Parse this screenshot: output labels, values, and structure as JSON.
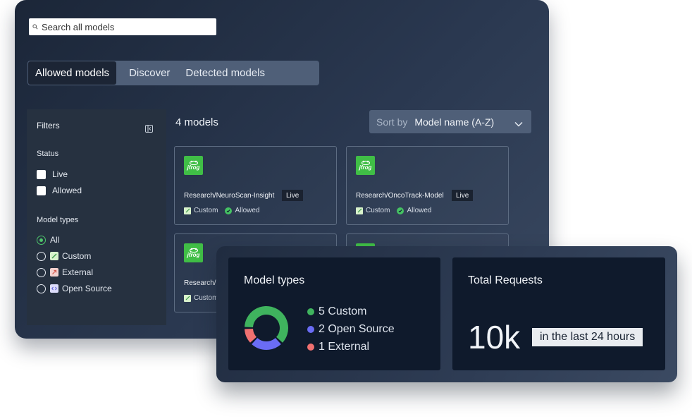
{
  "search": {
    "placeholder": "Search all models"
  },
  "tabs": [
    {
      "label": "Allowed models",
      "active": true
    },
    {
      "label": "Discover",
      "active": false
    },
    {
      "label": "Detected models",
      "active": false
    }
  ],
  "filters": {
    "title": "Filters",
    "status_label": "Status",
    "status_options": [
      "Live",
      "Allowed"
    ],
    "model_types_label": "Model types",
    "model_type_options": [
      {
        "label": "All",
        "selected": true
      },
      {
        "label": "Custom",
        "icon": "custom-icon"
      },
      {
        "label": "External",
        "icon": "external-icon"
      },
      {
        "label": "Open Source",
        "icon": "open-source-icon"
      }
    ]
  },
  "models": {
    "count_label": "4 models",
    "sort_label": "Sort by",
    "sort_value": "Model name (A-Z)",
    "cards": [
      {
        "logo": "jfrog",
        "name": "Research/NeuroScan-Insight",
        "status": "Live",
        "type": "Custom",
        "allowed": "Allowed"
      },
      {
        "logo": "jfrog",
        "name": "Research/OncoTrack-Model",
        "status": "Live",
        "type": "Custom",
        "allowed": "Allowed"
      },
      {
        "logo": "jfrog",
        "name": "Research/",
        "type": "Custom"
      }
    ]
  },
  "stats": {
    "model_types": {
      "title": "Model types",
      "legend": [
        {
          "label": "5 Custom",
          "value": 5,
          "color": "#3fb35e"
        },
        {
          "label": "2 Open Source",
          "value": 2,
          "color": "#6a6cf5"
        },
        {
          "label": "1 External",
          "value": 1,
          "color": "#f07070"
        }
      ]
    },
    "total_requests": {
      "title": "Total Requests",
      "value": "10k",
      "period": "in the last 24 hours"
    }
  },
  "colors": {
    "accent_green": "#40be46",
    "custom": "#3fb35e",
    "open_source": "#6a6cf5",
    "external": "#f07070"
  }
}
